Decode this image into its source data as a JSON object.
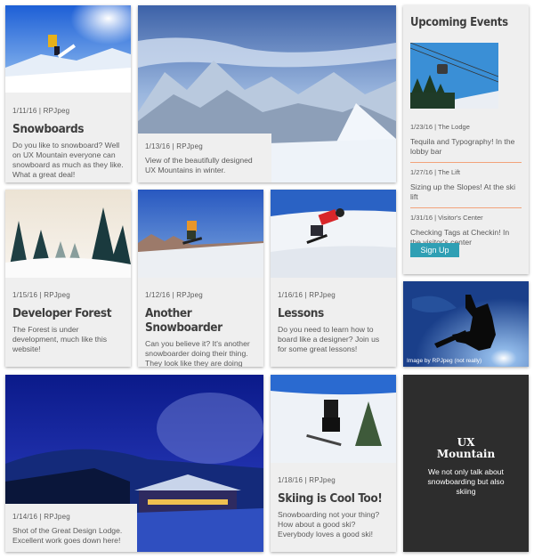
{
  "cards": {
    "snowboards": {
      "date": "1/11/16 | RPJpeg",
      "title": "Snowboards",
      "desc": "Do you like to snowboard? Well on UX Mountain everyone can snowboard as much as they like. What a great deal!"
    },
    "mountains": {
      "date": "1/13/16 | RPJpeg",
      "desc": "View of the beautifully designed UX Mountains in winter."
    },
    "forest": {
      "date": "1/15/16 | RPJpeg",
      "title": "Developer Forest",
      "desc": "The Forest is under development, much like this website!"
    },
    "snowboarder": {
      "date": "1/12/16 | RPJpeg",
      "title": "Another Snowboarder",
      "desc": "Can you believe it? It's another snowboarder doing their thing. They look like they are doing some great tricks!"
    },
    "lessons": {
      "date": "1/16/16 | RPJpeg",
      "title": "Lessons",
      "desc": "Do you need to learn how to board like a designer? Join us for some great lessons!"
    },
    "lodge": {
      "date": "1/14/16 | RPJpeg",
      "desc": "Shot of the Great Design Lodge. Excellent work goes down here!"
    },
    "skiing": {
      "date": "1/18/16 | RPJpeg",
      "title": "Skiing is Cool Too!",
      "desc": "Snowboarding not your thing? How about a good ski? Everybody loves a good ski!"
    },
    "silhouette": {
      "caption": "Image by RPJpeg (not really)"
    }
  },
  "events": {
    "heading": "Upcoming Events",
    "items": [
      {
        "date": "1/23/16 | The Lodge",
        "title": "Tequila and Typography! In the lobby bar"
      },
      {
        "date": "1/27/16 | The Lift",
        "title": "Sizing up the Slopes! At the ski lift"
      },
      {
        "date": "1/31/16 | Visitor's Center",
        "title": "Checking Tags at Checkin! In the visitor's center"
      }
    ],
    "signup_label": "Sign Up"
  },
  "brand": {
    "logo_line1": "UX",
    "logo_line2": "Mountain",
    "tagline": "We not only talk about snowboarding but also skiing"
  }
}
